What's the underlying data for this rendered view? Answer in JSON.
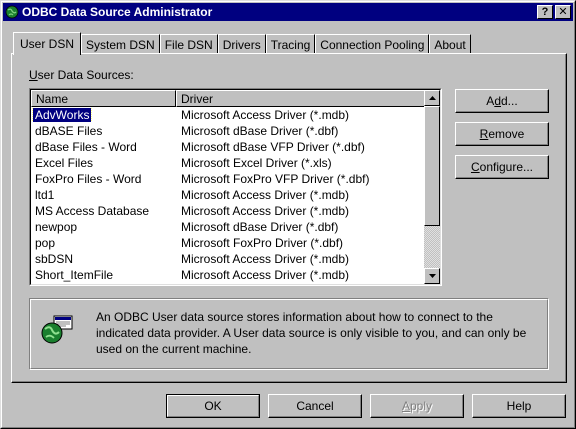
{
  "window": {
    "title": "ODBC Data Source Administrator",
    "help_btn": "?",
    "close_btn": "✕"
  },
  "tabs": [
    {
      "label": "User DSN",
      "active": true
    },
    {
      "label": "System DSN",
      "active": false
    },
    {
      "label": "File DSN",
      "active": false
    },
    {
      "label": "Drivers",
      "active": false
    },
    {
      "label": "Tracing",
      "active": false
    },
    {
      "label": "Connection Pooling",
      "active": false
    },
    {
      "label": "About",
      "active": false
    }
  ],
  "panel": {
    "section_label": "User Data Sources:",
    "columns": {
      "name": "Name",
      "driver": "Driver"
    },
    "rows": [
      {
        "name": "AdvWorks",
        "driver": "Microsoft Access Driver (*.mdb)",
        "selected": true
      },
      {
        "name": "dBASE Files",
        "driver": "Microsoft dBase Driver (*.dbf)"
      },
      {
        "name": "dBase Files - Word",
        "driver": "Microsoft dBase VFP Driver (*.dbf)"
      },
      {
        "name": "Excel Files",
        "driver": "Microsoft Excel Driver (*.xls)"
      },
      {
        "name": "FoxPro Files - Word",
        "driver": "Microsoft FoxPro VFP Driver (*.dbf)"
      },
      {
        "name": "ltd1",
        "driver": "Microsoft Access Driver (*.mdb)"
      },
      {
        "name": "MS Access Database",
        "driver": "Microsoft Access Driver (*.mdb)"
      },
      {
        "name": "newpop",
        "driver": "Microsoft dBase Driver (*.dbf)"
      },
      {
        "name": "pop",
        "driver": "Microsoft FoxPro Driver (*.dbf)"
      },
      {
        "name": "sbDSN",
        "driver": "Microsoft Access Driver (*.mdb)"
      },
      {
        "name": "Short_ItemFile",
        "driver": "Microsoft Access Driver (*.mdb)"
      }
    ],
    "buttons": {
      "add": "Add...",
      "remove": "Remove",
      "configure": "Configure..."
    },
    "info_text": "An ODBC User data source stores information about how to connect to the indicated data provider.   A User data source is only visible to you, and can only be used on the current machine."
  },
  "footer": {
    "ok": "OK",
    "cancel": "Cancel",
    "apply": "Apply",
    "help": "Help"
  },
  "colors": {
    "titlebar": "#000080",
    "face": "#c0c0c0",
    "selection": "#000080"
  }
}
